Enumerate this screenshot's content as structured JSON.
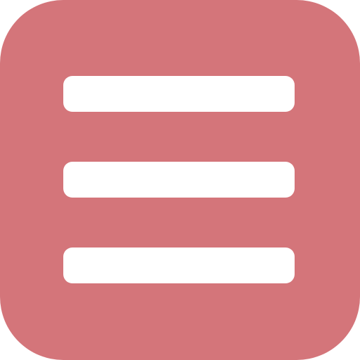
{
  "icon": {
    "name": "hamburger-menu-icon",
    "background_color": "#d4757a",
    "bar_color": "#ffffff",
    "bar_count": 3
  }
}
